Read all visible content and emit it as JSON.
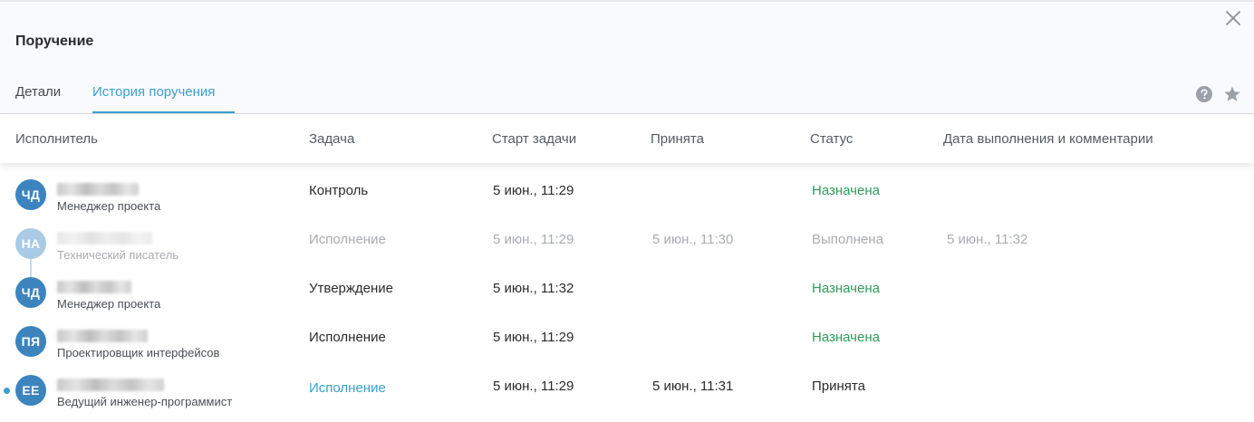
{
  "dialog": {
    "title": "Поручение",
    "tabs": [
      {
        "label": "Детали",
        "active": false
      },
      {
        "label": "История поручения",
        "active": true
      }
    ],
    "accent_color": "#3aa0cf",
    "icons": [
      "close-icon",
      "help-icon",
      "star-icon"
    ]
  },
  "table": {
    "columns": [
      "Исполнитель",
      "Задача",
      "Старт задачи",
      "Принята",
      "Статус",
      "Дата выполнения и комментарии"
    ],
    "rows": [
      {
        "initials": "ЧД",
        "role": "Менеджер проекта",
        "task": "Контроль",
        "start": "5 июн., 11:29",
        "accepted": "",
        "status": "Назначена",
        "done": "",
        "faded": false
      },
      {
        "initials": "НА",
        "role": "Технический писатель",
        "task": "Исполнение",
        "start": "5 июн., 11:29",
        "accepted": "5 июн., 11:30",
        "status": "Выполнена",
        "done": "5 июн., 11:32",
        "faded": true
      },
      {
        "initials": "ЧД",
        "role": "Менеджер проекта",
        "task": "Утверждение",
        "start": "5 июн., 11:32",
        "accepted": "",
        "status": "Назначена",
        "done": "",
        "faded": false
      },
      {
        "initials": "ПЯ",
        "role": "Проектировщик интерфейсов",
        "task": "Исполнение",
        "start": "5 июн., 11:29",
        "accepted": "",
        "status": "Назначена",
        "done": "",
        "faded": false
      },
      {
        "initials": "ЕЕ",
        "role": "Ведущий инженер-программист",
        "task": "Исполнение",
        "start": "5 июн., 11:29",
        "accepted": "5 июн., 11:31",
        "status": "Принята",
        "done": "",
        "faded": false
      }
    ],
    "status_colors": {
      "Назначена": "#2e9b5c",
      "Выполнена": "#a9acb0",
      "Принята": "#2b2b2b"
    }
  }
}
